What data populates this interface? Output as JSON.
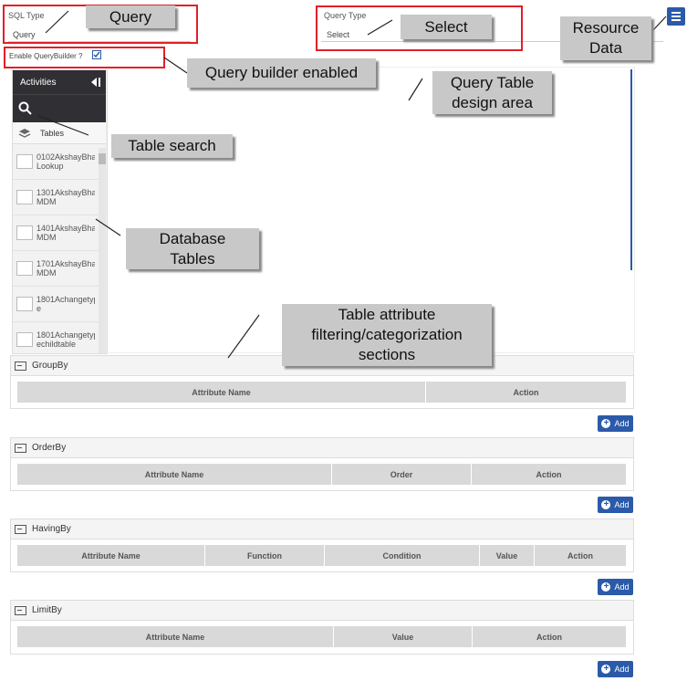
{
  "sql_type": {
    "label": "SQL Type",
    "value": "Query"
  },
  "query_type": {
    "label": "Query Type",
    "value": "Select"
  },
  "enable_qb": {
    "label": "Enable QueryBuilder ?",
    "checked": true
  },
  "sidebar": {
    "title": "Activities",
    "tabs_label": "Tables",
    "tables": [
      "0102AkshayBha\nLookup",
      "1301AkshayBha\nMDM",
      "1401AkshayBha\nMDM",
      "1701AkshayBha\nMDM",
      "1801Achangetyp\ne",
      "1801Achangetyp\nechildtable"
    ]
  },
  "groupby": {
    "title": "GroupBy",
    "columns": [
      "Attribute Name",
      "Action"
    ],
    "add": "Add"
  },
  "orderby": {
    "title": "OrderBy",
    "columns": [
      "Attribute Name",
      "Order",
      "Action"
    ],
    "add": "Add"
  },
  "havingby": {
    "title": "HavingBy",
    "columns": [
      "Attribute Name",
      "Function",
      "Condition",
      "Value",
      "Action"
    ],
    "add": "Add"
  },
  "limitby": {
    "title": "LimitBy",
    "columns": [
      "Attribute Name",
      "Value",
      "Action"
    ],
    "add": "Add"
  },
  "callouts": {
    "query": "Query",
    "select": "Select",
    "resource": "Resource\nData",
    "qb_enabled": "Query builder enabled",
    "design_area": "Query Table\ndesign area",
    "table_search": "Table search",
    "db_tables": "Database\nTables",
    "filtering": "Table attribute\nfiltering/categorization\nsections"
  },
  "colors": {
    "accent": "#2b5aa8",
    "highlight": "#e0202a",
    "sidebar_dark": "#2f2f34"
  }
}
